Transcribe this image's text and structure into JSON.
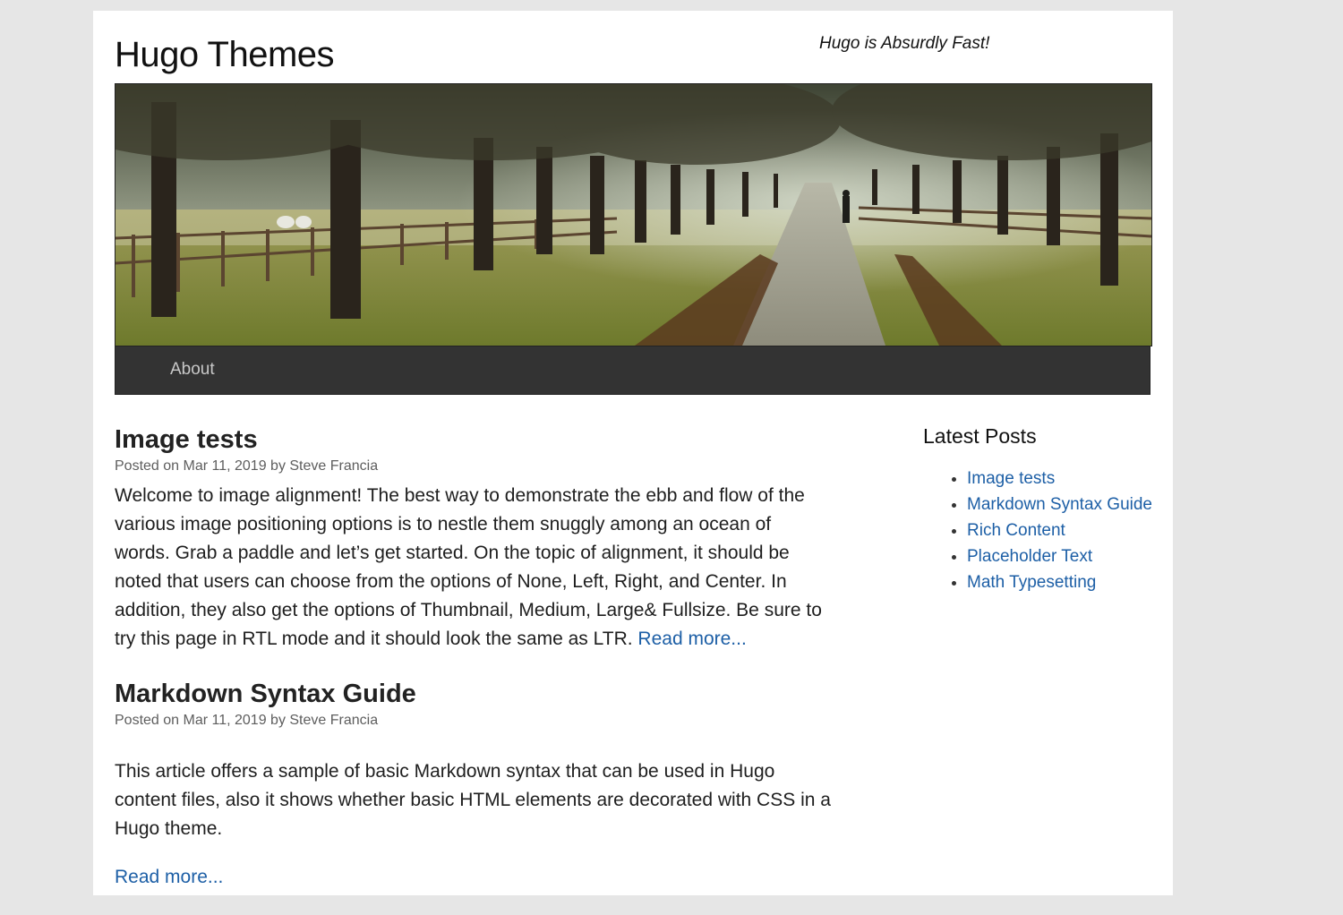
{
  "site": {
    "title": "Hugo Themes",
    "tagline": "Hugo is Absurdly Fast!"
  },
  "banner": {
    "image": "tree-lined country lane with fences and a walker"
  },
  "nav": {
    "items": [
      {
        "label": "About"
      }
    ]
  },
  "posts": [
    {
      "title": "Image tests",
      "meta": "Posted on Mar 11, 2019 by Steve Francia",
      "excerpt": "Welcome to image alignment! The best way to demonstrate the ebb and flow of the various image positioning options is to nestle them snuggly among an ocean of words. Grab a paddle and let’s get started. On the topic of alignment, it should be noted that users can choose from the options of None, Left, Right, and Center. In addition, they also get the options of Thumbnail, Medium, Large& Fullsize. Be sure to try this page in RTL mode and it should look the same as LTR.",
      "read_more": "Read more..."
    },
    {
      "title": "Markdown Syntax Guide",
      "meta": "Posted on Mar 11, 2019 by Steve Francia",
      "excerpt": "This article offers a sample of basic Markdown syntax that can be used in Hugo content files, also it shows whether basic HTML elements are decorated with CSS in a Hugo theme.",
      "read_more": "Read more..."
    }
  ],
  "sidebar": {
    "heading": "Latest Posts",
    "links": [
      "Image tests",
      "Markdown Syntax Guide",
      "Rich Content",
      "Placeholder Text",
      "Math Typesetting"
    ]
  },
  "colors": {
    "background": "#e6e6e6",
    "page": "#ffffff",
    "navbar": "#333333",
    "link": "#1d5fa6"
  }
}
